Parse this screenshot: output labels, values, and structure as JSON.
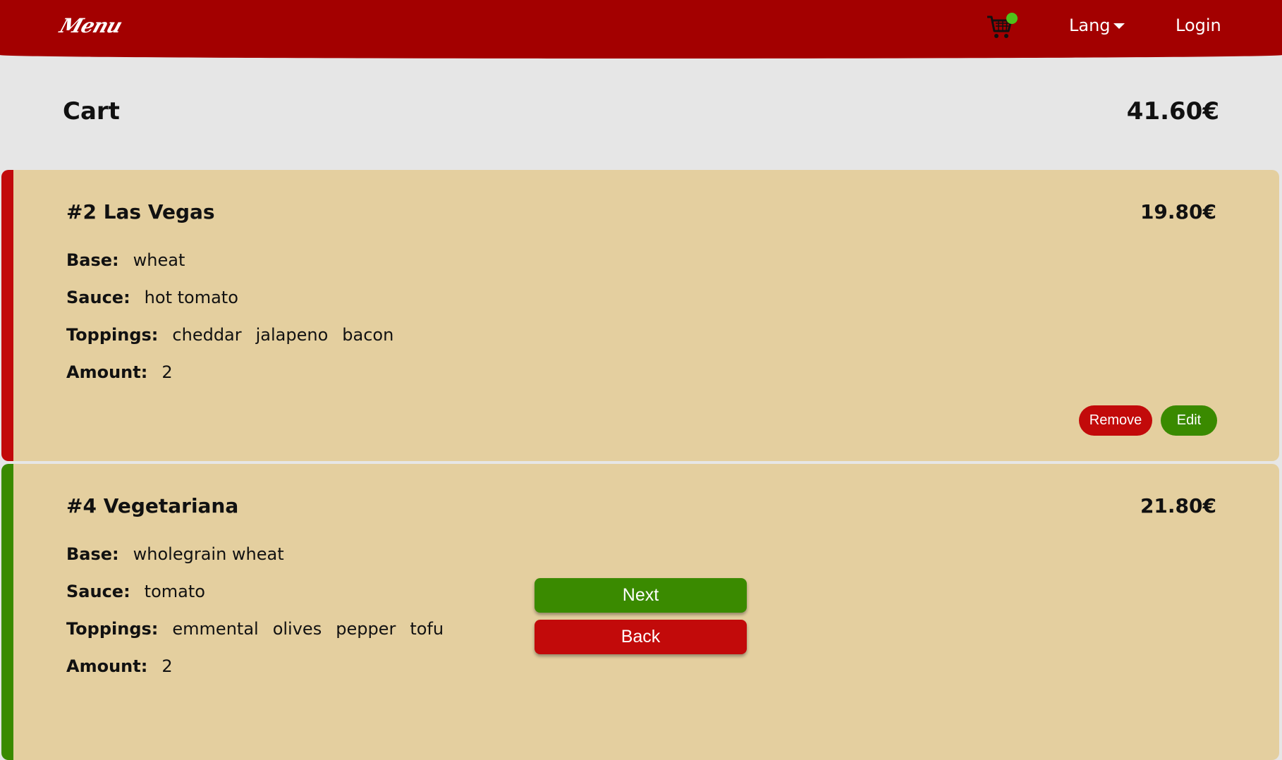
{
  "header": {
    "logo": "Menu",
    "lang_label": "Lang",
    "login_label": "Login"
  },
  "cart": {
    "title": "Cart",
    "total": "41.60€"
  },
  "labels": {
    "base": "Base:",
    "sauce": "Sauce:",
    "toppings": "Toppings:",
    "amount": "Amount:"
  },
  "items": [
    {
      "name": "#2 Las Vegas",
      "price": "19.80€",
      "base": "wheat",
      "sauce": "hot tomato",
      "toppings": [
        "cheddar",
        "jalapeno",
        "bacon"
      ],
      "amount": "2",
      "remove_label": "Remove",
      "edit_label": "Edit"
    },
    {
      "name": "#4 Vegetariana",
      "price": "21.80€",
      "base": "wholegrain wheat",
      "sauce": "tomato",
      "toppings": [
        "emmental",
        "olives",
        "pepper",
        "tofu"
      ],
      "amount": "2"
    }
  ],
  "nav": {
    "next_label": "Next",
    "back_label": "Back"
  },
  "colors": {
    "header_red": "#a30000",
    "accent_red": "#c20a0a",
    "accent_green": "#3a8a00",
    "card_bg": "#e4cf9f",
    "page_bg": "#e6e6e6",
    "cart_badge": "#4fc21a"
  }
}
